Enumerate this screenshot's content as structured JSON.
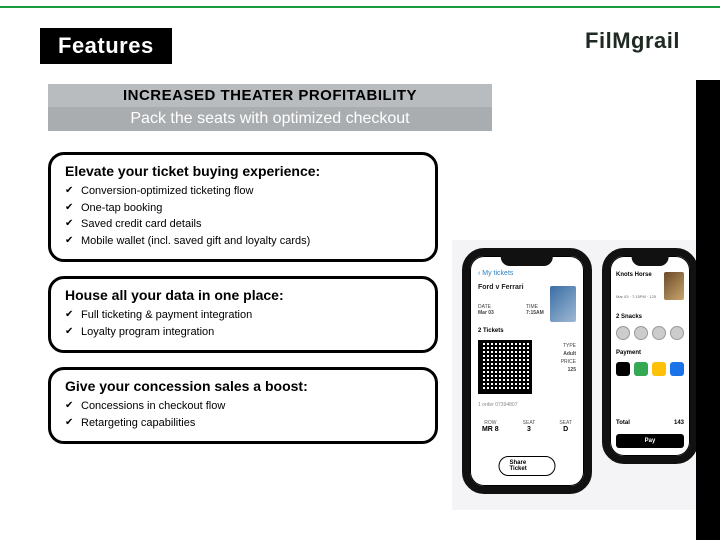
{
  "header": {
    "tag": "Features",
    "logo_a": "Fil",
    "logo_m": "M",
    "logo_b": "grail"
  },
  "banner": {
    "title": "INCREASED THEATER PROFITABILITY",
    "sub": "Pack the seats with optimized checkout"
  },
  "cards": [
    {
      "title": "Elevate your ticket buying experience:",
      "items": [
        "Conversion-optimized ticketing flow",
        "One-tap booking",
        "Saved credit card details",
        "Mobile wallet (incl. saved gift and loyalty cards)"
      ]
    },
    {
      "title": "House all your data in one place:",
      "items": [
        "Full ticketing & payment integration",
        "Loyalty program integration"
      ]
    },
    {
      "title": "Give your concession sales a boost:",
      "items": [
        "Concessions in checkout flow",
        "Retargeting capabilities"
      ]
    }
  ],
  "phoneA": {
    "back": "My tickets",
    "movie": "Ford v Ferrari",
    "date_lbl": "DATE",
    "date": "Mar 03",
    "time_lbl": "TIME",
    "time": "7:15AM",
    "tickets": "2 Tickets",
    "type_lbl": "TYPE",
    "type": "Adult",
    "price_lbl": "PRICE",
    "price": "125",
    "order": "1 order 07394807",
    "row_lbl": "ROW",
    "row_v": "MR 8",
    "seat_lbl": "SEAT",
    "seat_v1": "3",
    "seat_v2": "D",
    "btn": "Share Ticket"
  },
  "phoneB": {
    "movie": "Knots Horse",
    "date": "Mar 03",
    "time": "7:15PM",
    "price": "125",
    "snacks": "2 Snacks",
    "pay": "Payment",
    "total_lbl": "Total",
    "total": "143",
    "btn": "Pay"
  }
}
